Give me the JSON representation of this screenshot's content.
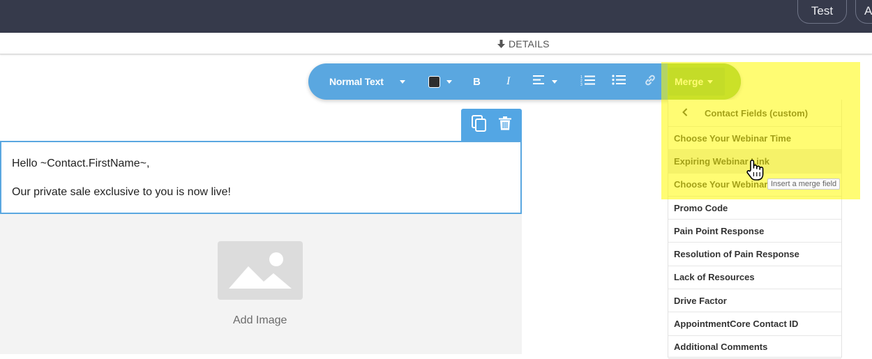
{
  "header": {
    "test_label": "Test",
    "second_button_label": "A"
  },
  "details": {
    "label": "DETAILS",
    "icon": "arrow-down-icon"
  },
  "toolbar": {
    "text_style": "Normal Text",
    "bold_label": "B",
    "italic_label": "I",
    "merge_label": "Merge",
    "text_color": "#2e2e2e",
    "bar_color": "#5aa7e0",
    "merge_color": "#7db85a"
  },
  "merge_dropdown": {
    "title": "Contact Fields (custom)",
    "items": [
      {
        "label": "Choose Your Webinar Time"
      },
      {
        "label": "Expiring Webinar Link"
      },
      {
        "label": "Choose Your Webinar Day"
      },
      {
        "label": "Promo Code"
      },
      {
        "label": "Pain Point Response"
      },
      {
        "label": "Resolution of Pain Response"
      },
      {
        "label": "Lack of Resources"
      },
      {
        "label": "Drive Factor"
      },
      {
        "label": "AppointmentCore Contact ID"
      },
      {
        "label": "Additional Comments"
      }
    ],
    "hover_index": 1,
    "tooltip": "Insert a merge field"
  },
  "editor": {
    "line1": "Hello ~Contact.FirstName~,",
    "line2": "Our private sale exclusive to you is now live!"
  },
  "image_block": {
    "label": "Add Image"
  }
}
